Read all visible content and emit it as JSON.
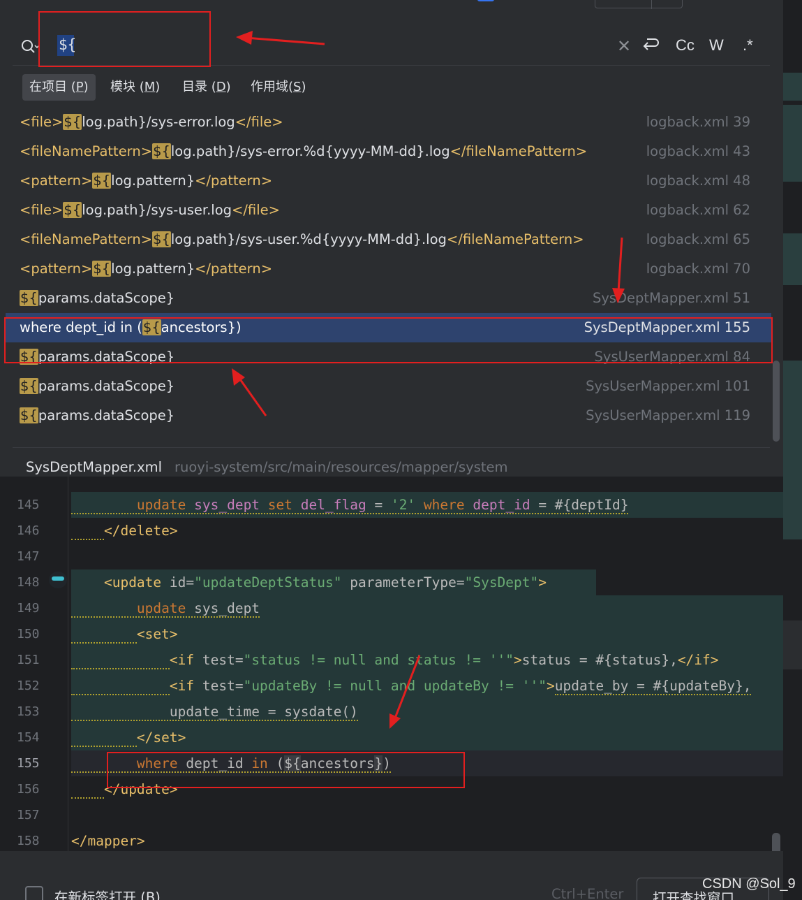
{
  "search": {
    "query": "${",
    "options": {
      "case": "Cc",
      "words": "W",
      "regex": ".*"
    }
  },
  "scope_tabs": [
    {
      "label": "在项目",
      "key": "P"
    },
    {
      "label": "模块",
      "key": "M"
    },
    {
      "label": "目录",
      "key": "D"
    },
    {
      "label": "作用域",
      "key": "S"
    }
  ],
  "results": [
    {
      "pre": "",
      "tag_open": "<file>",
      "hl": "${",
      "rest": "log.path}/sys-error.log",
      "tag_close": "</file>",
      "file": "logback.xml 39"
    },
    {
      "pre": "",
      "tag_open": "<fileNamePattern>",
      "hl": "${",
      "rest": "log.path}/sys-error.%d{yyyy-MM-dd}.log",
      "tag_close": "</fileNamePattern>",
      "file": "logback.xml 43"
    },
    {
      "pre": "",
      "tag_open": "<pattern>",
      "hl": "${",
      "rest": "log.pattern}",
      "tag_close": "</pattern>",
      "file": "logback.xml 48"
    },
    {
      "pre": "",
      "tag_open": "<file>",
      "hl": "${",
      "rest": "log.path}/sys-user.log",
      "tag_close": "</file>",
      "file": "logback.xml 62"
    },
    {
      "pre": "",
      "tag_open": "<fileNamePattern>",
      "hl": "${",
      "rest": "log.path}/sys-user.%d{yyyy-MM-dd}.log",
      "tag_close": "</fileNamePattern>",
      "file": "logback.xml 65"
    },
    {
      "pre": "",
      "tag_open": "<pattern>",
      "hl": "${",
      "rest": "log.pattern}",
      "tag_close": "</pattern>",
      "file": "logback.xml 70"
    },
    {
      "pre": "",
      "tag_open": "",
      "hl": "${",
      "rest": "params.dataScope}",
      "tag_close": "",
      "file": "SysDeptMapper.xml 51"
    },
    {
      "pre": "where dept_id in (",
      "tag_open": "",
      "hl": "${",
      "rest": "ancestors})",
      "tag_close": "",
      "file": "SysDeptMapper.xml 155",
      "selected": true
    },
    {
      "pre": "",
      "tag_open": "",
      "hl": "${",
      "rest": "params.dataScope}",
      "tag_close": "",
      "file": "SysUserMapper.xml 84"
    },
    {
      "pre": "",
      "tag_open": "",
      "hl": "${",
      "rest": "params.dataScope}",
      "tag_close": "",
      "file": "SysUserMapper.xml 101"
    },
    {
      "pre": "",
      "tag_open": "",
      "hl": "${",
      "rest": "params.dataScope}",
      "tag_close": "",
      "file": "SysUserMapper.xml 119"
    }
  ],
  "preview": {
    "file": "SysDeptMapper.xml",
    "path": "ruoyi-system/src/main/resources/mapper/system"
  },
  "code": {
    "line_numbers": [
      "145",
      "146",
      "147",
      "148",
      "149",
      "150",
      "151",
      "152",
      "153",
      "154",
      "155",
      "156",
      "157",
      "158"
    ],
    "current_line": "155"
  },
  "footer": {
    "new_tab_label": "在新标签打开",
    "new_tab_key": "B",
    "shortcut": "Ctrl+Enter",
    "open_find_window": "打开查找窗口"
  },
  "watermark": "CSDN @Sol_9"
}
